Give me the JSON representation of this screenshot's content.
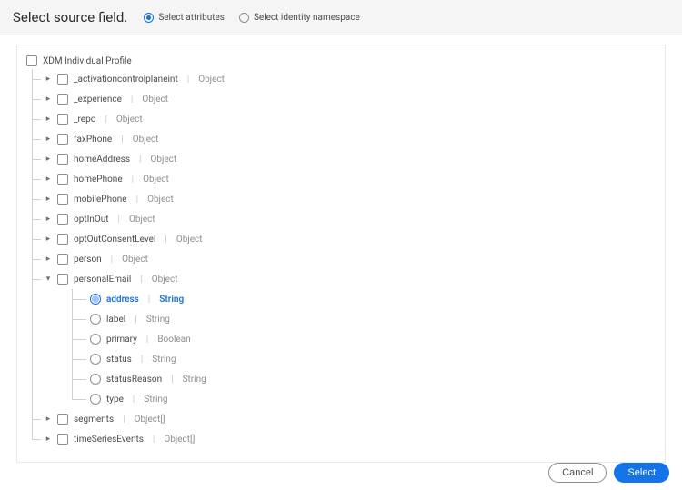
{
  "header": {
    "title": "Select source field.",
    "radios": {
      "attributes": "Select attributes",
      "identity": "Select identity namespace"
    }
  },
  "root": {
    "label": "XDM Individual Profile"
  },
  "nodes": [
    {
      "name": "_activationcontrolplaneint",
      "type": "Object"
    },
    {
      "name": "_experience",
      "type": "Object"
    },
    {
      "name": "_repo",
      "type": "Object"
    },
    {
      "name": "faxPhone",
      "type": "Object"
    },
    {
      "name": "homeAddress",
      "type": "Object"
    },
    {
      "name": "homePhone",
      "type": "Object"
    },
    {
      "name": "mobilePhone",
      "type": "Object"
    },
    {
      "name": "optInOut",
      "type": "Object"
    },
    {
      "name": "optOutConsentLevel",
      "type": "Object"
    },
    {
      "name": "person",
      "type": "Object"
    }
  ],
  "personalEmail": {
    "name": "personalEmail",
    "type": "Object"
  },
  "emailChildren": [
    {
      "name": "address",
      "type": "String",
      "selected": true
    },
    {
      "name": "label",
      "type": "String"
    },
    {
      "name": "primary",
      "type": "Boolean"
    },
    {
      "name": "status",
      "type": "String"
    },
    {
      "name": "statusReason",
      "type": "String"
    },
    {
      "name": "type",
      "type": "String"
    }
  ],
  "tailNodes": [
    {
      "name": "segments",
      "type": "Object[]"
    },
    {
      "name": "timeSeriesEvents",
      "type": "Object[]"
    }
  ],
  "buttons": {
    "cancel": "Cancel",
    "select": "Select"
  }
}
